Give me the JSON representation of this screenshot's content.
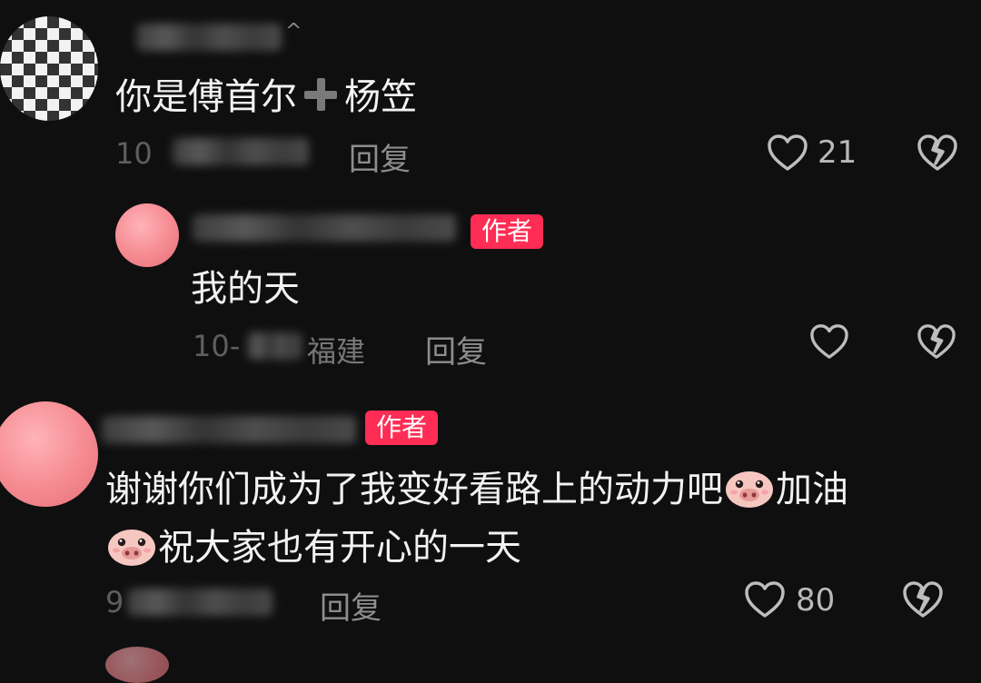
{
  "comments": [
    {
      "text_before": "你是傅首尔",
      "icon": "plus-icon",
      "text_after": "杨笠",
      "meta": "10",
      "reply_label": "回复",
      "likes": "21"
    },
    {
      "badge": "作者",
      "text": "我的天",
      "meta": "10-",
      "meta_suffix": "福建",
      "reply_label": "回复"
    },
    {
      "badge": "作者",
      "line1_text": "谢谢你们成为了我变好看路上的动力吧",
      "line1_tail": "加油",
      "line2_text": "祝大家也有开心的一天",
      "meta": "9",
      "reply_label": "回复",
      "likes": "80"
    }
  ],
  "colors": {
    "background": "#0f0f10",
    "badge": "#ff2d55",
    "text": "#f2f2f2",
    "muted": "#8d8d8d"
  }
}
